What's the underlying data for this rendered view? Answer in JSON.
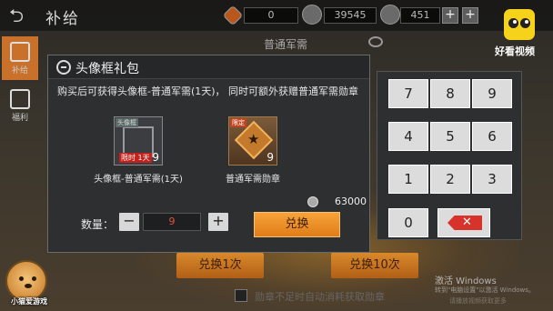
{
  "header": {
    "title": "补给",
    "back_icon": "back-arrow-icon",
    "resources": [
      {
        "value": "0",
        "icon": "orange-diamond-icon"
      },
      {
        "value": "39545",
        "icon": "coin-icon"
      },
      {
        "value": "451",
        "icon": "bullet-icon"
      }
    ]
  },
  "sidebar": {
    "items": [
      {
        "label": "补给",
        "active": true
      },
      {
        "label": "福利",
        "active": false
      }
    ]
  },
  "section": {
    "header": "普通军需"
  },
  "background_buttons": {
    "once": "兑换1次",
    "ten": "兑换10次",
    "hint": "勋章不足时自动消耗获取勋章"
  },
  "dialog": {
    "title": "头像框礼包",
    "description": "购买后可获得头像框-普通军需(1天)， 同时可额外获赠普通军需勋章",
    "items": [
      {
        "tag": "头像框",
        "name": "头像框-普通军需(1天)",
        "count": "9",
        "badge": "限时 1天"
      },
      {
        "tag": "限定",
        "name": "普通军需勋章",
        "count": "9"
      }
    ],
    "price": "63000",
    "quantity_label": "数量：",
    "quantity_value": "9",
    "minus": "−",
    "plus": "+",
    "exchange_label": "兑换"
  },
  "keypad": {
    "keys": [
      "7",
      "8",
      "9",
      "4",
      "5",
      "6",
      "1",
      "2",
      "3",
      "0"
    ],
    "delete_symbol": "✕"
  },
  "watermark": {
    "line1": "激活 Windows",
    "line2": "转到\"电脑设置\"以激活 Windows。",
    "line3": "请播放视频获取更多"
  },
  "branding": {
    "logo_text": "好看视频",
    "avatar_text": "小猫爱游戏"
  },
  "colors": {
    "accent_orange": "#e07d19",
    "delete_red": "#d8332a",
    "quantity_red": "#e0533a",
    "logo_yellow": "#f7d21b"
  }
}
